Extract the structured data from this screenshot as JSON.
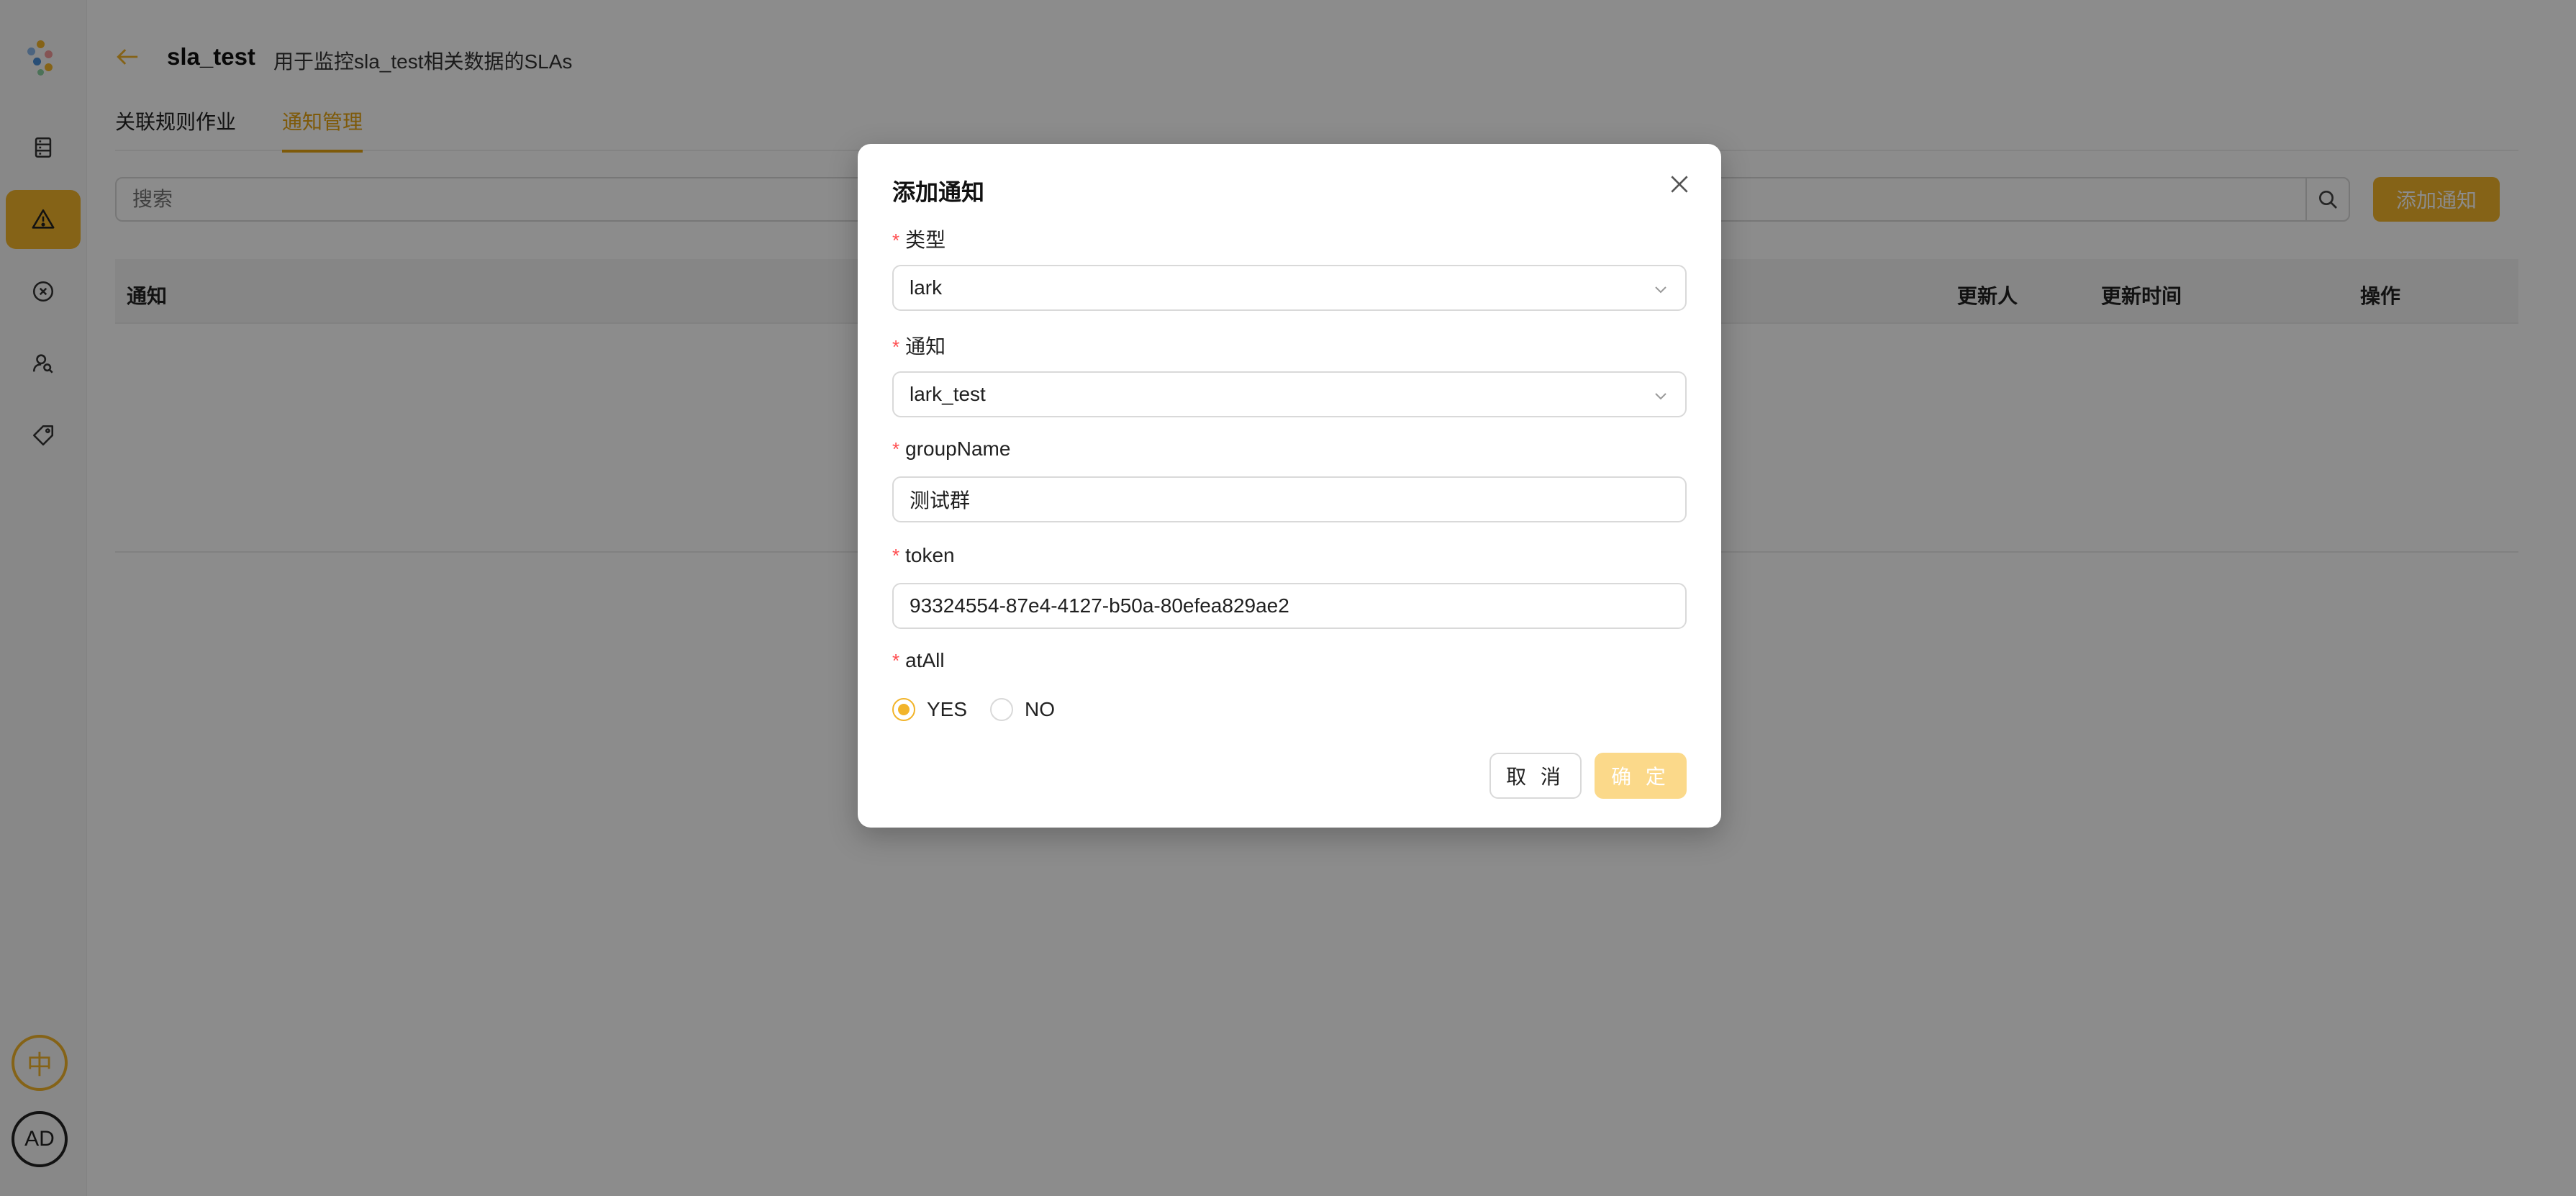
{
  "header": {
    "title": "sla_test",
    "subtitle": "用于监控sla_test相关数据的SLAs"
  },
  "tabs": [
    {
      "label": "关联规则作业",
      "active": false
    },
    {
      "label": "通知管理",
      "active": true
    }
  ],
  "search": {
    "placeholder": "搜索"
  },
  "toolbar": {
    "add_label": "添加通知"
  },
  "table": {
    "columns": [
      "通知",
      "更新人",
      "更新时间",
      "操作"
    ],
    "rows": []
  },
  "sidebar": {
    "items": [
      {
        "icon": "database-icon",
        "active": false
      },
      {
        "icon": "alert-triangle-icon",
        "active": true
      },
      {
        "icon": "close-circle-icon",
        "active": false
      },
      {
        "icon": "user-search-icon",
        "active": false
      },
      {
        "icon": "tag-icon",
        "active": false
      }
    ],
    "lang_label": "中",
    "user_label": "AD"
  },
  "modal": {
    "title": "添加通知",
    "fields": {
      "type": {
        "label": "类型",
        "value": "lark"
      },
      "notify": {
        "label": "通知",
        "value": "lark_test"
      },
      "group_name": {
        "label": "groupName",
        "value": "测试群"
      },
      "token": {
        "label": "token",
        "value": "93324554-87e4-4127-b50a-80efea829ae2"
      },
      "at_all": {
        "label": "atAll",
        "options": [
          "YES",
          "NO"
        ],
        "selected": "YES"
      }
    },
    "cancel_label": "取 消",
    "ok_label": "确 定"
  },
  "colors": {
    "accent": "#f2b42a",
    "required": "#ff4d4f",
    "ok_disabled": "#fbd98a"
  }
}
